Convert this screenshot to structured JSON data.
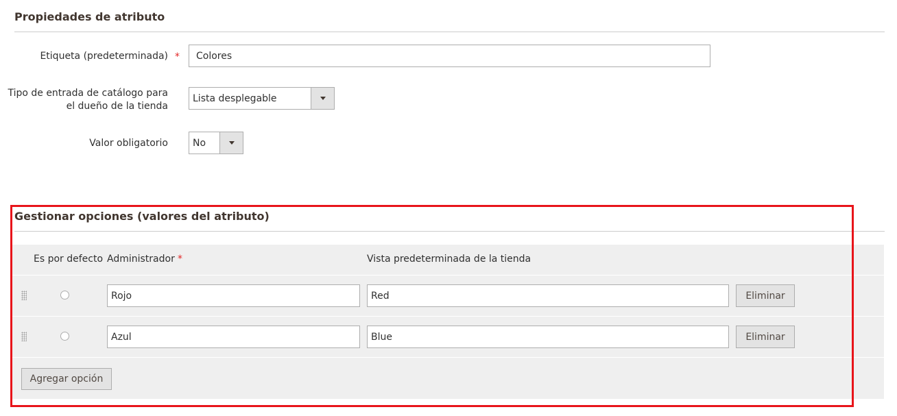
{
  "attribute_properties": {
    "title": "Propiedades de atributo",
    "label_field": {
      "label": "Etiqueta (predeterminada)",
      "required_mark": "*",
      "value": "Colores"
    },
    "input_type_field": {
      "label_line1": "Tipo de entrada de catálogo para",
      "label_line2": "el dueño de la tienda",
      "selected": "Lista desplegable"
    },
    "required_field": {
      "label": "Valor obligatorio",
      "selected": "No"
    }
  },
  "manage_options": {
    "title": "Gestionar opciones (valores del atributo)",
    "highlight_color": "#e8141a",
    "columns": {
      "is_default": "Es por defecto",
      "admin": "Administrador",
      "admin_required_mark": "*",
      "store_view": "Vista predeterminada de la tienda"
    },
    "rows": [
      {
        "admin": "Rojo",
        "store_view": "Red",
        "delete_label": "Eliminar",
        "is_default": false
      },
      {
        "admin": "Azul",
        "store_view": "Blue",
        "delete_label": "Eliminar",
        "is_default": false
      }
    ],
    "add_option_label": "Agregar opción"
  }
}
